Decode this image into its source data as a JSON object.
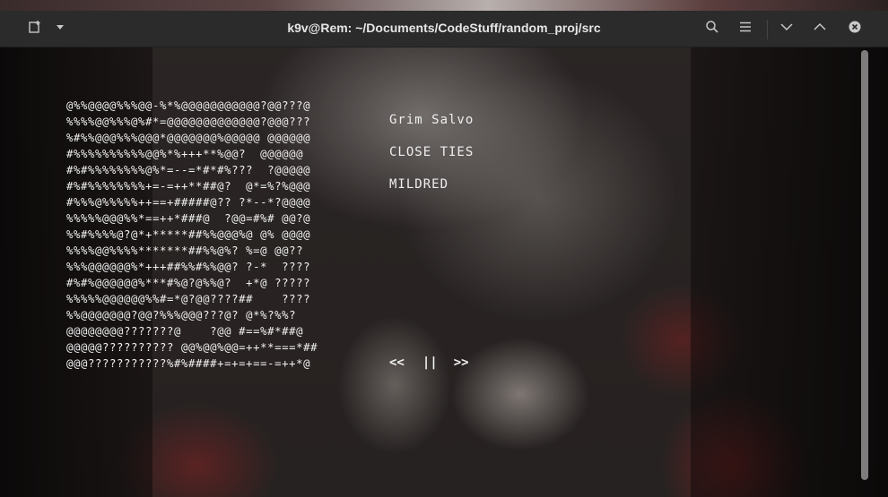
{
  "window": {
    "title": "k9v@Rem: ~/Documents/CodeStuff/random_proj/src"
  },
  "titlebar_icons": {
    "new_tab": "new-tab-icon",
    "dropdown": "chevron-down-icon",
    "search": "search-icon",
    "menu": "hamburger-menu-icon",
    "minimize": "chevron-down-icon",
    "maximize": "chevron-up-icon",
    "close": "close-circle-icon"
  },
  "ascii_art": [
    "@%%@@@@%%%@@-%*%@@@@@@@@@@@?@@???@",
    "%%%%@@%%%@%#*=@@@@@@@@@@@@@?@@@???",
    "%#%%@@@%%%@@@*@@@@@@@%@@@@@ @@@@@@",
    "#%%%%%%%%%%@@%*%+++**%@@?  @@@@@@",
    "#%#%%%%%%%%@%*=--=*#*#%???  ?@@@@@",
    "#%#%%%%%%%%+=-=++**##@?  @*=%?%@@@",
    "#%%%@%%%%%++==+#####@?? ?*--*?@@@@",
    "%%%%%@@@%%*==++*###@  ?@@=#%# @@?@",
    "%%#%%%%@?@*+*****##%%@@@%@ @% @@@@",
    "%%%%@@%%%%*******##%%@%? %=@ @@??",
    "%%%@@@@@@%*+++##%%#%%@@? ?-*  ????",
    "#%#%@@@@@@%***#%@?@%%@?  +*@ ?????",
    "%%%%%@@@@@@%%#=*@?@@????##    ????",
    "%%@@@@@@@?@@?%%%@@@???@? @*%?%%?",
    "@@@@@@@@???????@    ?@@ #==%#*##@",
    "@@@@@?????????? @@%@@%@@=++**===*##",
    "@@@???????????%#%####+=+=+==-=++*@"
  ],
  "track": {
    "artist": "Grim Salvo",
    "title": "CLOSE TIES",
    "album": "MILDRED"
  },
  "controls": {
    "prev": "<<",
    "pause": "||",
    "next": ">>"
  }
}
